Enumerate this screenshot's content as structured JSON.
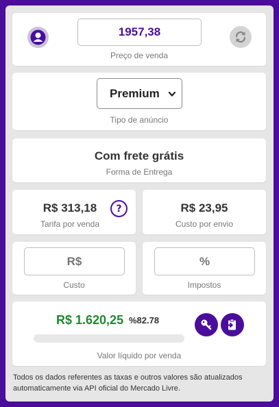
{
  "price": {
    "value": "1957,38",
    "label": "Preço de venda"
  },
  "ad_type": {
    "selected": "Premium",
    "label": "Tipo de anúncio"
  },
  "delivery": {
    "value": "Com frete grátis",
    "label": "Forma de Entrega"
  },
  "fee": {
    "value": "R$ 313,18",
    "label": "Tarifa por venda"
  },
  "shipping": {
    "value": "R$ 23,95",
    "label": "Custo por envio"
  },
  "cost": {
    "placeholder": "R$",
    "label": "Custo"
  },
  "taxes": {
    "placeholder": "%",
    "label": "Impostos"
  },
  "net": {
    "value": "R$ 1.620,25",
    "percent": "%82.78",
    "progress": 0,
    "label": "Valor líquido por venda"
  },
  "footer": {
    "text": "Todos os dados referentes as taxas e outros valores são atualizados automaticamente via API oficial do Mercado Livre."
  },
  "icons": {
    "avatar": "user-avatar-icon",
    "refresh": "refresh-icon",
    "help": "question-icon",
    "key": "key-icon",
    "export": "clipboard-export-icon"
  },
  "colors": {
    "brand": "#4a0d9c",
    "net_value": "#1e8a2e",
    "muted": "#777777"
  }
}
